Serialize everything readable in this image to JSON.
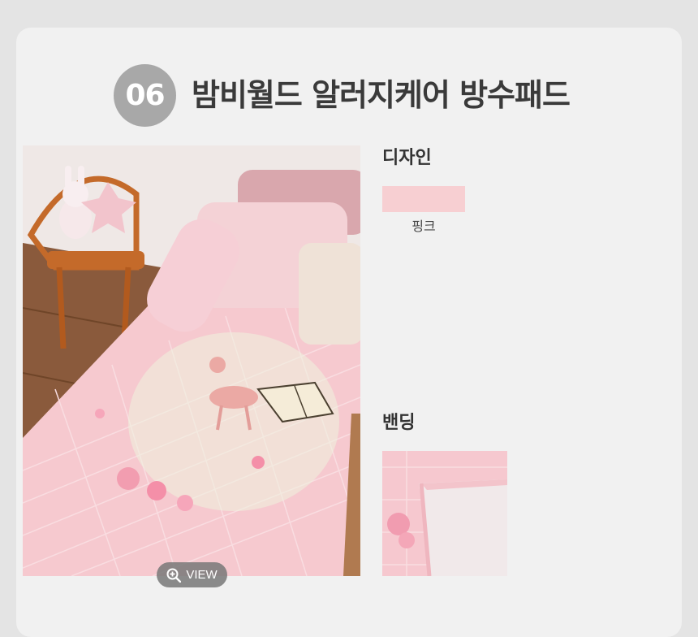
{
  "header": {
    "number": "06",
    "title": "밤비월드 알러지케어 방수패드"
  },
  "main_image": {
    "view_button_label": "VIEW",
    "icon": "zoom-in-icon"
  },
  "design": {
    "label": "디자인",
    "swatch_color": "#f7cfd2",
    "swatch_name": "핑크"
  },
  "banding": {
    "label": "밴딩"
  }
}
